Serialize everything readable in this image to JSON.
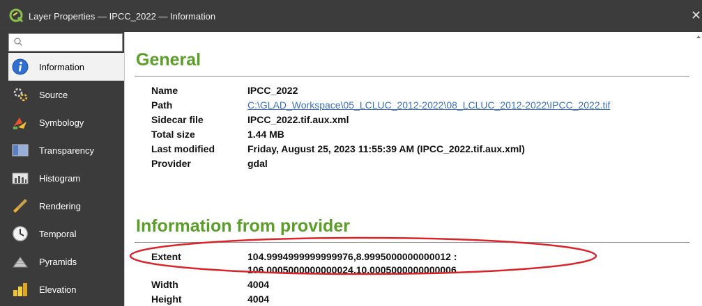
{
  "window": {
    "title": "Layer Properties — IPCC_2022 — Information",
    "close_glyph": "✕"
  },
  "search": {
    "placeholder": ""
  },
  "sidebar": {
    "items": [
      {
        "label": "Information",
        "icon": "info-icon",
        "active": true
      },
      {
        "label": "Source",
        "icon": "source-icon"
      },
      {
        "label": "Symbology",
        "icon": "symbology-icon"
      },
      {
        "label": "Transparency",
        "icon": "transparency-icon"
      },
      {
        "label": "Histogram",
        "icon": "histogram-icon"
      },
      {
        "label": "Rendering",
        "icon": "rendering-icon"
      },
      {
        "label": "Temporal",
        "icon": "temporal-icon"
      },
      {
        "label": "Pyramids",
        "icon": "pyramids-icon"
      },
      {
        "label": "Elevation",
        "icon": "elevation-icon"
      }
    ]
  },
  "general": {
    "title": "General",
    "rows": [
      {
        "label": "Name",
        "value": "IPCC_2022"
      },
      {
        "label": "Path",
        "value": "C:\\GLAD_Workspace\\05_LCLUC_2012-2022\\08_LCLUC_2012-2022\\IPCC_2022.tif"
      },
      {
        "label": "Sidecar file",
        "value": "IPCC_2022.tif.aux.xml"
      },
      {
        "label": "Total size",
        "value": "1.44 MB"
      },
      {
        "label": "Last modified",
        "value": "Friday, August 25, 2023 11:55:39 AM (IPCC_2022.tif.aux.xml)"
      },
      {
        "label": "Provider",
        "value": "gdal"
      }
    ]
  },
  "provider": {
    "title": "Information from provider",
    "extent_label": "Extent",
    "extent_line1": "104.9994999999999976,8.9995000000000012 :",
    "extent_line2": "106.0005000000000024,10.0005000000000006",
    "rows": [
      {
        "label": "Width",
        "value": "4004"
      },
      {
        "label": "Height",
        "value": "4004"
      }
    ]
  },
  "colors": {
    "section_title": "#5a9e28",
    "link": "#3a6fc4",
    "highlight_oval": "#d9242b",
    "sidebar_bg": "#3b3b3b",
    "titlebar_bg": "#3c3c3c"
  }
}
